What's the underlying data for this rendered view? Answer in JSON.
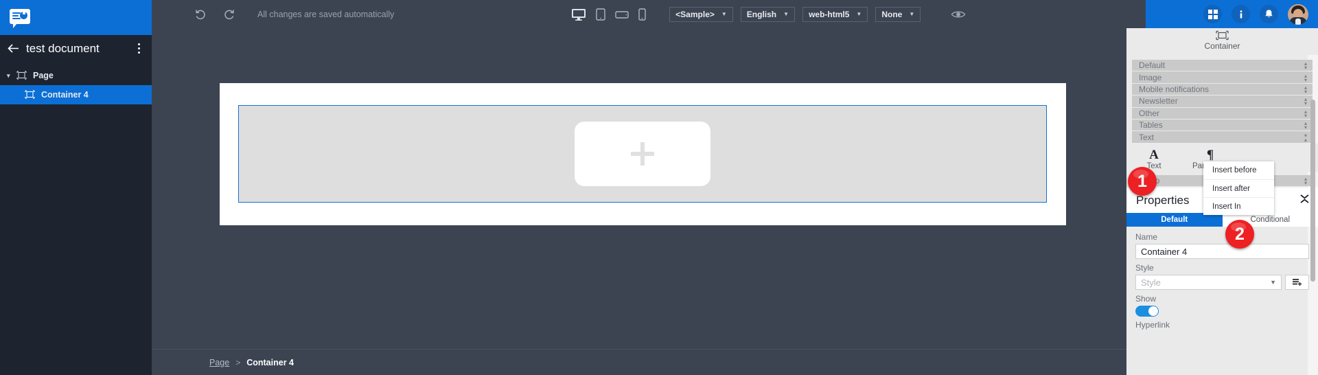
{
  "sidebar": {
    "logo_icon": "speech-bubble-logo-icon",
    "back_icon": "arrow-left-icon",
    "document_title": "test document",
    "kebab_icon": "more-vertical-icon",
    "tree": [
      {
        "label": "Page",
        "icon": "container-node-icon",
        "caret": "▾",
        "selected": false,
        "level": 0
      },
      {
        "label": "Container 4",
        "icon": "container-node-icon",
        "caret": "",
        "selected": true,
        "level": 1
      }
    ]
  },
  "toolbar": {
    "undo_icon": "undo-icon",
    "redo_icon": "redo-icon",
    "status_text": "All changes are saved automatically",
    "devices": [
      {
        "name": "desktop-icon",
        "active": true
      },
      {
        "name": "tablet-portrait-icon",
        "active": false
      },
      {
        "name": "tablet-landscape-icon",
        "active": false
      },
      {
        "name": "mobile-icon",
        "active": false
      }
    ],
    "selects": [
      {
        "name": "sample-select",
        "value": "<Sample>"
      },
      {
        "name": "language-select",
        "value": "English"
      },
      {
        "name": "output-select",
        "value": "web-html5"
      },
      {
        "name": "variant-select",
        "value": "None"
      }
    ],
    "preview_icon": "eye-icon",
    "apps_icon": "grid-apps-icon",
    "info_icon": "info-icon",
    "notifications_icon": "bell-icon",
    "avatar_icon": "user-avatar"
  },
  "canvas": {
    "add_button_icon": "plus-icon",
    "breadcrumb": {
      "parent": "Page",
      "separator": ">",
      "current": "Container 4"
    }
  },
  "right_panel": {
    "header": {
      "icon": "container-node-icon",
      "label": "Container"
    },
    "accordion": [
      {
        "label": "Default",
        "state": "collapsed"
      },
      {
        "label": "Image",
        "state": "collapsed"
      },
      {
        "label": "Mobile notifications",
        "state": "collapsed"
      },
      {
        "label": "Newsletter",
        "state": "collapsed"
      },
      {
        "label": "Other",
        "state": "collapsed"
      },
      {
        "label": "Tables",
        "state": "collapsed"
      },
      {
        "label": "Text",
        "state": "expanded"
      }
    ],
    "tools": [
      {
        "glyph": "A",
        "label": "Text",
        "icon": "text-tool-icon"
      },
      {
        "glyph": "¶",
        "label": "Paragraph",
        "icon": "paragraph-tool-icon"
      }
    ],
    "video_row": {
      "label": "Video",
      "state": "collapsed"
    },
    "context_menu": [
      {
        "label": "Insert before"
      },
      {
        "label": "Insert after"
      },
      {
        "label": "Insert In"
      }
    ],
    "properties": {
      "title": "Properties",
      "close_icon": "collapse-icon",
      "tabs": [
        {
          "label": "Default",
          "active": true
        },
        {
          "label": "Conditional",
          "active": false
        }
      ],
      "name_label": "Name",
      "name_value": "Container 4",
      "style_label": "Style",
      "style_placeholder": "Style",
      "style_add_icon": "add-style-icon",
      "show_label": "Show",
      "show_enabled": true,
      "next_label": "Hyperlink"
    }
  },
  "badges": [
    {
      "number": "1"
    },
    {
      "number": "2"
    }
  ],
  "colors": {
    "accent_blue": "#0b6fd6",
    "toolbar_dark": "#3c4452",
    "sidebar_dark": "#1d2430",
    "panel_gray": "#eaeaea",
    "badge_red": "#ed2024"
  }
}
